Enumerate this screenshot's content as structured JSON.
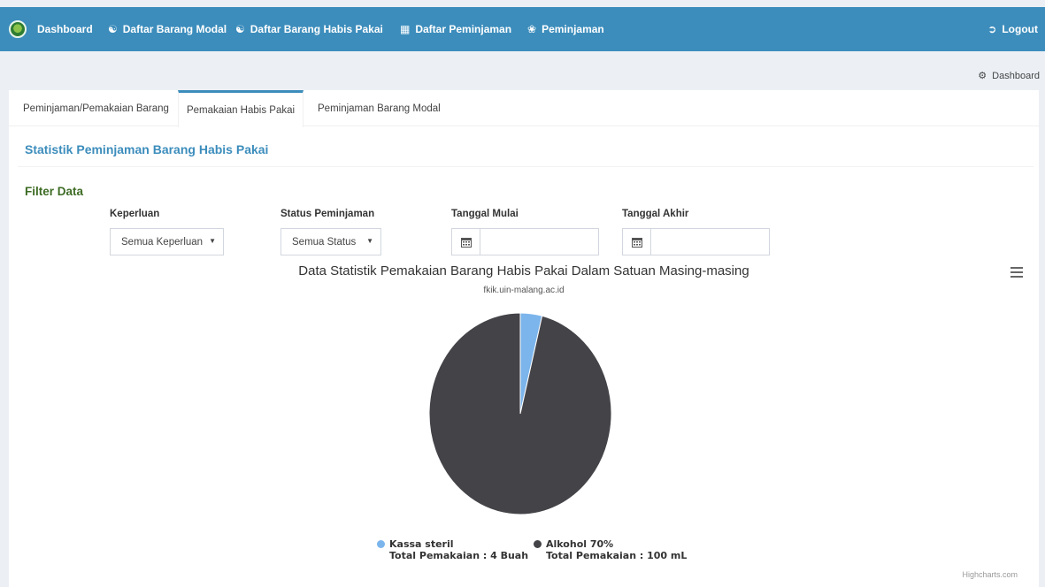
{
  "nav": {
    "items": [
      {
        "label": "Dashboard",
        "icon": "logo"
      },
      {
        "label": "Daftar Barang Modal",
        "icon": "cubes-icon"
      },
      {
        "label": "Daftar Barang Habis Pakai",
        "icon": "cubes-icon"
      },
      {
        "label": "Daftar Peminjaman",
        "icon": "grid-icon"
      },
      {
        "label": "Peminjaman",
        "icon": "leaf-icon"
      }
    ],
    "logout": "Logout"
  },
  "breadcrumb": {
    "label": "Dashboard"
  },
  "tabs": [
    {
      "label": "Peminjaman/Pemakaian Barang"
    },
    {
      "label": "Pemakaian Habis Pakai",
      "active": true
    },
    {
      "label": "Peminjaman Barang Modal"
    }
  ],
  "section_title": "Statistik Peminjaman Barang Habis Pakai",
  "filter": {
    "title": "Filter Data",
    "keperluan_label": "Keperluan",
    "keperluan_value": "Semua Keperluan",
    "status_label": "Status Peminjaman",
    "status_value": "Semua Status",
    "tanggal_mulai_label": "Tanggal Mulai",
    "tanggal_mulai_value": "",
    "tanggal_akhir_label": "Tanggal Akhir",
    "tanggal_akhir_value": ""
  },
  "chart_data": {
    "type": "pie",
    "title": "Data Statistik Pemakaian Barang Habis Pakai Dalam Satuan Masing-masing",
    "subtitle": "fkik.uin-malang.ac.id",
    "slices": [
      {
        "name": "Kassa steril",
        "detail": "Total Pemakaian : 4 Buah",
        "value": 4,
        "color": "#7cb5ec"
      },
      {
        "name": "Alkohol 70%",
        "detail": "Total Pemakaian : 100 mL",
        "value": 100,
        "color": "#434348"
      }
    ],
    "legend": "bottom-center",
    "credit": "Highcharts.com"
  }
}
